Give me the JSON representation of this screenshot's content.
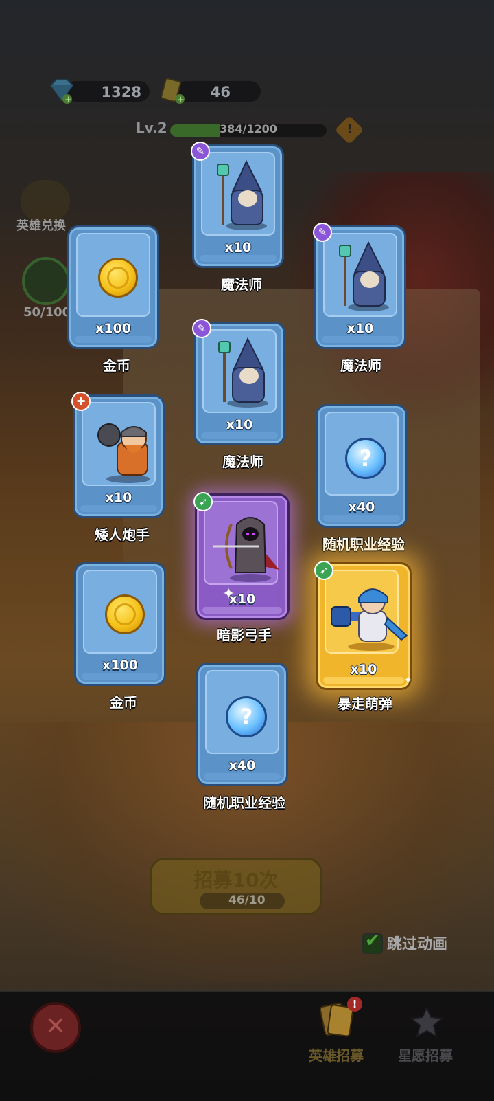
{
  "top": {
    "gems": "1328",
    "tickets": "46",
    "level": "Lv.2",
    "xp_text": "384/1200",
    "xp_fraction": 0.32,
    "warning_glyph": "!"
  },
  "side": {
    "hero_exchange_label": "英雄兑换",
    "star_progress": "50/100"
  },
  "rewards": [
    {
      "name": "魔法师",
      "qty": "x10",
      "rarity": "blue",
      "class_icon": "staff-icon",
      "art": "wizard"
    },
    {
      "name": "金币",
      "qty": "x100",
      "rarity": "blue",
      "art": "gold-coin"
    },
    {
      "name": "魔法师",
      "qty": "x10",
      "rarity": "blue",
      "class_icon": "staff-icon",
      "art": "wizard"
    },
    {
      "name": "魔法师",
      "qty": "x10",
      "rarity": "blue",
      "class_icon": "staff-icon",
      "art": "wizard"
    },
    {
      "name": "矮人炮手",
      "qty": "x10",
      "rarity": "blue",
      "class_icon": "cannon-icon",
      "art": "dwarf"
    },
    {
      "name": "随机职业经验",
      "qty": "x40",
      "rarity": "blue",
      "art": "exp-orb"
    },
    {
      "name": "暗影弓手",
      "qty": "x10",
      "rarity": "purple",
      "class_icon": "bow-icon",
      "art": "archer"
    },
    {
      "name": "金币",
      "qty": "x100",
      "rarity": "blue",
      "art": "gold-coin"
    },
    {
      "name": "暴走萌弹",
      "qty": "x10",
      "rarity": "gold",
      "class_icon": "bow-icon",
      "art": "knight"
    },
    {
      "name": "随机职业经验",
      "qty": "x40",
      "rarity": "blue",
      "art": "exp-orb"
    }
  ],
  "recruit": {
    "button_label": "招募10次",
    "cost": "46/10",
    "skip_label": "跳过动画",
    "skip_checked": true
  },
  "nav": {
    "hero_recruit": "英雄招募",
    "wish_recruit": "星愿招募",
    "alert_glyph": "!"
  },
  "colors": {
    "card_blue": "#5b93c9",
    "card_purple": "#8a5bc4",
    "card_gold": "#f0b52a",
    "active_tab": "#e5b53a"
  }
}
